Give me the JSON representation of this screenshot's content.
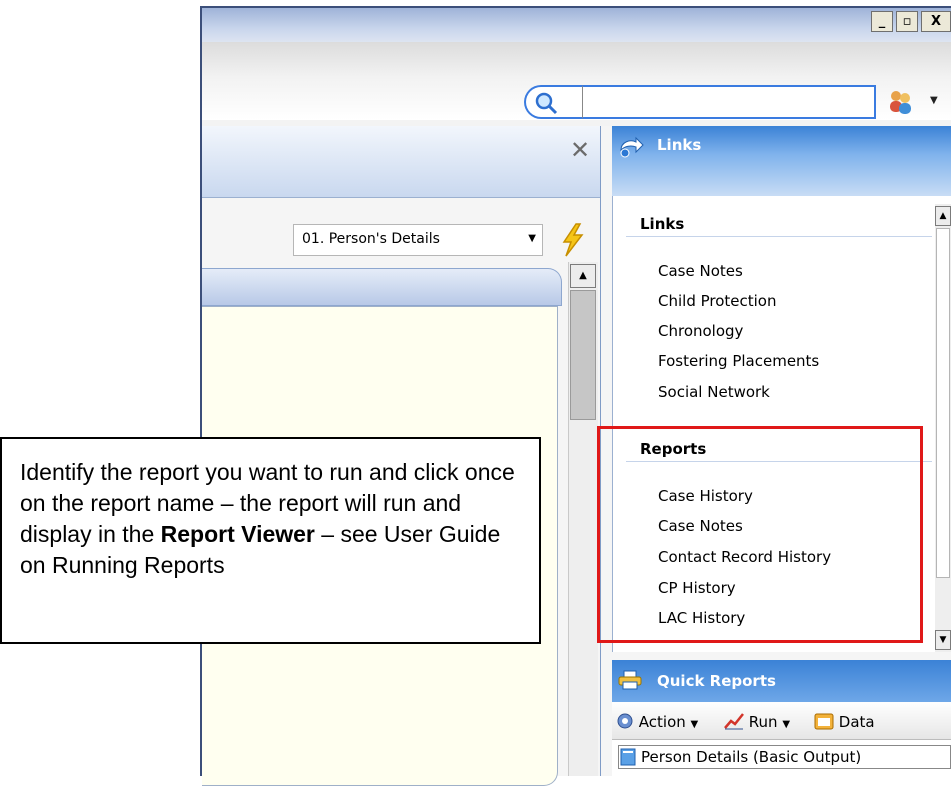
{
  "window": {
    "controls": {
      "minimize": "_",
      "maximize": "▫",
      "close": "X"
    }
  },
  "search": {
    "value": "",
    "placeholder": ""
  },
  "left_panel": {
    "form_select": {
      "value": "01. Person's Details"
    }
  },
  "links_panel": {
    "title": "Links",
    "links_section": {
      "heading": "Links",
      "items": [
        "Case Notes",
        "Child Protection",
        "Chronology",
        "Fostering Placements",
        "Social Network"
      ]
    },
    "reports_section": {
      "heading": "Reports",
      "items": [
        "Case History",
        "Case Notes",
        "Contact Record History",
        "CP History",
        "LAC History"
      ]
    }
  },
  "quick_reports": {
    "title": "Quick Reports",
    "toolbar": {
      "action": "Action",
      "run": "Run",
      "data": "Data"
    },
    "items": [
      "Person Details (Basic Output)"
    ]
  },
  "callout": {
    "text_before": "Identify the report you want to run and click once on the report name – the report will run and display in the ",
    "bold": "Report Viewer",
    "text_after": " – see User Guide on Running Reports"
  },
  "colors": {
    "highlight": "#e01818",
    "header_blue": "#3b82d6",
    "search_border": "#3a7be0"
  },
  "icons": [
    "search-icon",
    "people-icon",
    "close-icon",
    "lightning-icon",
    "links-arrow-icon",
    "printer-icon",
    "action-gear-icon",
    "run-chart-icon",
    "data-icon",
    "report-doc-icon"
  ]
}
